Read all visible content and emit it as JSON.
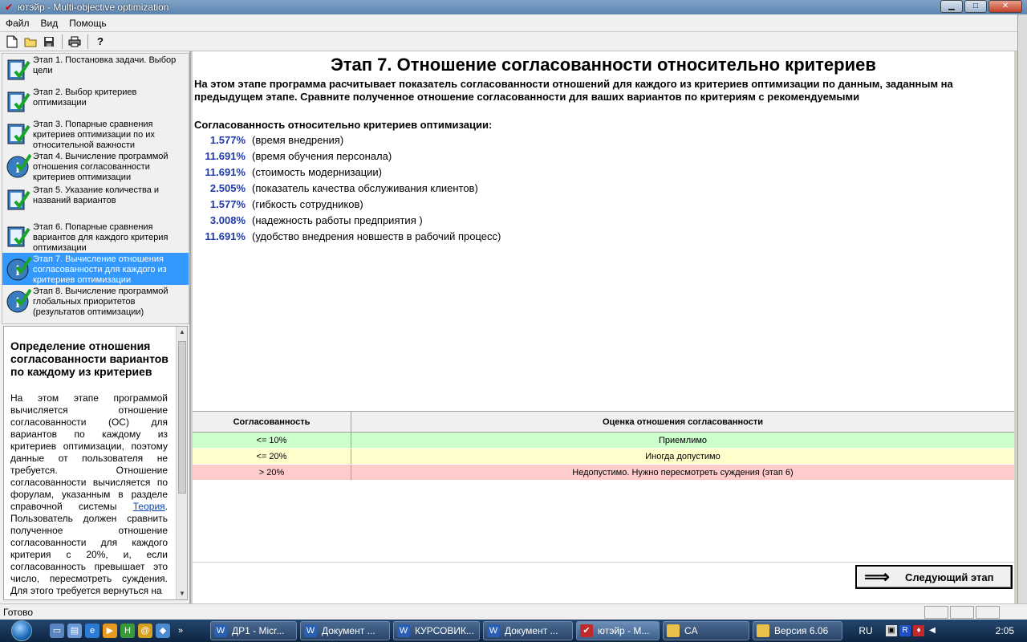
{
  "window": {
    "title": "ютэйр - Multi-objective optimization"
  },
  "menu": [
    "Файл",
    "Вид",
    "Помощь"
  ],
  "steps": [
    {
      "label": "Этап 1. Постановка задачи. Выбор цели",
      "icon": "checked-document-icon"
    },
    {
      "label": "Этап 2. Выбор критериев оптимизации",
      "icon": "checked-document-icon"
    },
    {
      "label": "Этап 3. Попарные сравнения критериев оптимизации по их относительной важности",
      "icon": "checked-document-icon"
    },
    {
      "label": "Этап 4. Вычисление программой отношения согласованности критериев оптимизации",
      "icon": "checked-info-icon"
    },
    {
      "label": "Этап 5. Указание количества и названий вариантов",
      "icon": "checked-document-icon"
    },
    {
      "label": "Этап 6. Попарные сравнения вариантов для каждого критерия оптимизации",
      "icon": "checked-document-icon"
    },
    {
      "label": "Этап 7. Вычисление отношения согласованности для каждого из критериев оптимизации",
      "icon": "checked-info-icon",
      "active": true
    },
    {
      "label": "Этап 8. Вычисление программой глобальных приоритетов (результатов оптимизации)",
      "icon": "info-icon"
    }
  ],
  "help": {
    "title": "Определение отношения согласованности вариантов по каждому из критериев",
    "body_before_link": "На этом этапе программой вычисляется отношение согласованности (ОС) для вариантов по каждому из критериев оптимизации, поэтому данные от пользователя не требуется. Отношение согласованности вычисляется по форулам, указанным в разделе справочной системы ",
    "link": "Теория",
    "body_after_link": ". Пользователь должен сравнить полученное отношение согласованности для каждого критерия с 20%, и, если согласованность превышает это число, пересмотреть суждения. Для этого требуется вернуться на"
  },
  "main": {
    "title": "Этап 7. Отношение согласованности относительно критериев",
    "description": "На этом этапе программа расчитывает показатель согласованности отношений для каждого из критериев оптимизации по данным, заданным на предыдущем этапе. Сравните полученное отношение согласованности для ваших вариантов по критериям с рекомендуемыми",
    "consistency_header": "Согласованность относительно критериев оптимизации:",
    "criteria": [
      {
        "value": "1.577%",
        "name": "(время внедрения)"
      },
      {
        "value": "11.691%",
        "name": "(время обучения персонала)"
      },
      {
        "value": "11.691%",
        "name": "(стоимость модернизации)"
      },
      {
        "value": "2.505%",
        "name": "(показатель качества обслуживания клиентов)"
      },
      {
        "value": "1.577%",
        "name": "(гибкость сотрудников)"
      },
      {
        "value": "3.008%",
        "name": "(надежность работы предприятия )"
      },
      {
        "value": "11.691%",
        "name": "(удобство внедрения новшеств в рабочий процесс)"
      }
    ]
  },
  "table": {
    "headers": [
      "Согласованность",
      "Оценка отношения согласованности"
    ],
    "rows": [
      {
        "threshold": "<= 10%",
        "assessment": "Приемлимо",
        "color": "#ccffcc"
      },
      {
        "threshold": "<= 20%",
        "assessment": "Иногда допустимо",
        "color": "#ffffcc"
      },
      {
        "threshold": "> 20%",
        "assessment": "Недопустимо. Нужно пересмотреть суждения (этап 6)",
        "color": "#ffcccc"
      }
    ]
  },
  "next_button": "Следующий этап",
  "status": "Готово",
  "taskbar": {
    "tasks": [
      {
        "label": "ДР1 - Micr...",
        "icon": "word-icon"
      },
      {
        "label": "Документ ...",
        "icon": "word-icon"
      },
      {
        "label": "КУРСОВИК...",
        "icon": "word-icon"
      },
      {
        "label": "Документ ...",
        "icon": "word-icon"
      },
      {
        "label": "ютэйр - M...",
        "icon": "app-icon",
        "active": true
      },
      {
        "label": "CA",
        "icon": "folder-icon"
      },
      {
        "label": "Версия 6.06",
        "icon": "folder-icon"
      }
    ],
    "lang": "RU",
    "clock": "2:05"
  }
}
